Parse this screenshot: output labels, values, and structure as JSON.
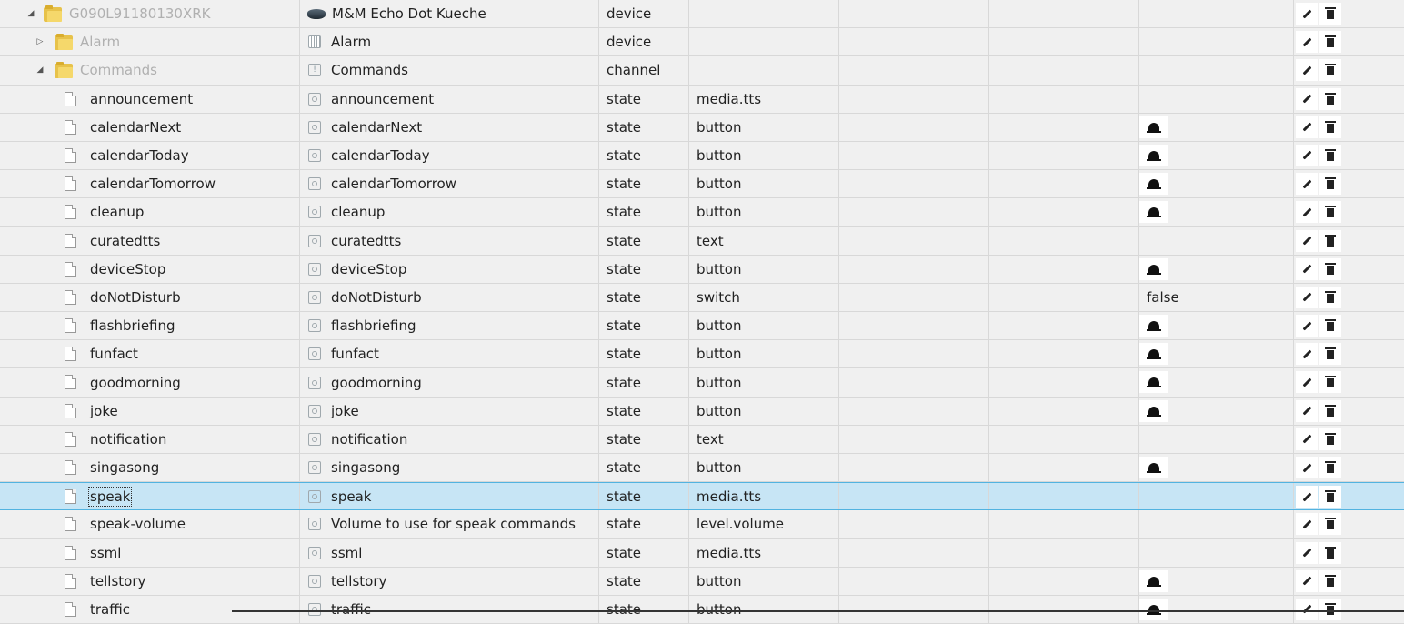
{
  "table": {
    "rows": [
      {
        "id": "G090L91180130XRK",
        "name": "M&M Echo Dot Kueche",
        "type": "device",
        "role": "",
        "value": "",
        "level": 0,
        "kind": "folder",
        "twisty": "open",
        "icon": "echo-dot-icon",
        "grey": true
      },
      {
        "id": "Alarm",
        "name": "Alarm",
        "type": "device",
        "role": "",
        "value": "",
        "level": 1,
        "kind": "folder",
        "twisty": "closed",
        "icon": "alarm-device-icon",
        "grey": true
      },
      {
        "id": "Commands",
        "name": "Commands",
        "type": "channel",
        "role": "",
        "value": "",
        "level": 1,
        "kind": "folder",
        "twisty": "open",
        "icon": "commands-channel-icon",
        "grey": true
      },
      {
        "id": "announcement",
        "name": "announcement",
        "type": "state",
        "role": "media.tts",
        "value": "",
        "level": 2,
        "kind": "file"
      },
      {
        "id": "calendarNext",
        "name": "calendarNext",
        "type": "state",
        "role": "button",
        "value": "",
        "level": 2,
        "kind": "file",
        "button": true
      },
      {
        "id": "calendarToday",
        "name": "calendarToday",
        "type": "state",
        "role": "button",
        "value": "",
        "level": 2,
        "kind": "file",
        "button": true
      },
      {
        "id": "calendarTomorrow",
        "name": "calendarTomorrow",
        "type": "state",
        "role": "button",
        "value": "",
        "level": 2,
        "kind": "file",
        "button": true
      },
      {
        "id": "cleanup",
        "name": "cleanup",
        "type": "state",
        "role": "button",
        "value": "",
        "level": 2,
        "kind": "file",
        "button": true
      },
      {
        "id": "curatedtts",
        "name": "curatedtts",
        "type": "state",
        "role": "text",
        "value": "",
        "level": 2,
        "kind": "file"
      },
      {
        "id": "deviceStop",
        "name": "deviceStop",
        "type": "state",
        "role": "button",
        "value": "",
        "level": 2,
        "kind": "file",
        "button": true
      },
      {
        "id": "doNotDisturb",
        "name": "doNotDisturb",
        "type": "state",
        "role": "switch",
        "value": "false",
        "level": 2,
        "kind": "file"
      },
      {
        "id": "flashbriefing",
        "name": "flashbriefing",
        "type": "state",
        "role": "button",
        "value": "",
        "level": 2,
        "kind": "file",
        "button": true
      },
      {
        "id": "funfact",
        "name": "funfact",
        "type": "state",
        "role": "button",
        "value": "",
        "level": 2,
        "kind": "file",
        "button": true
      },
      {
        "id": "goodmorning",
        "name": "goodmorning",
        "type": "state",
        "role": "button",
        "value": "",
        "level": 2,
        "kind": "file",
        "button": true
      },
      {
        "id": "joke",
        "name": "joke",
        "type": "state",
        "role": "button",
        "value": "",
        "level": 2,
        "kind": "file",
        "button": true
      },
      {
        "id": "notification",
        "name": "notification",
        "type": "state",
        "role": "text",
        "value": "",
        "level": 2,
        "kind": "file"
      },
      {
        "id": "singasong",
        "name": "singasong",
        "type": "state",
        "role": "button",
        "value": "",
        "level": 2,
        "kind": "file",
        "button": true
      },
      {
        "id": "speak",
        "name": "speak",
        "type": "state",
        "role": "media.tts",
        "value": "",
        "level": 2,
        "kind": "file",
        "selected": true
      },
      {
        "id": "speak-volume",
        "name": "Volume to use for speak commands",
        "type": "state",
        "role": "level.volume",
        "value": "",
        "level": 2,
        "kind": "file"
      },
      {
        "id": "ssml",
        "name": "ssml",
        "type": "state",
        "role": "media.tts",
        "value": "",
        "level": 2,
        "kind": "file"
      },
      {
        "id": "tellstory",
        "name": "tellstory",
        "type": "state",
        "role": "button",
        "value": "",
        "level": 2,
        "kind": "file",
        "button": true
      },
      {
        "id": "traffic",
        "name": "traffic",
        "type": "state",
        "role": "button",
        "value": "",
        "level": 2,
        "kind": "file",
        "button": true
      }
    ]
  },
  "icons": {
    "edit": "pencil-icon",
    "delete": "trash-icon",
    "press": "bell-icon",
    "state": "state-icon"
  },
  "colors": {
    "selected_row": "#c7e5f5",
    "selected_border": "#52b3e0",
    "folder": "#e7c24a"
  }
}
